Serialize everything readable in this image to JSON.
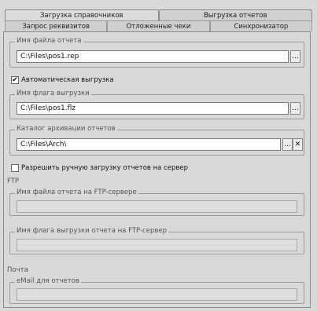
{
  "tabs_top": [
    {
      "label": "Загрузка справочников",
      "active": true
    },
    {
      "label": "Выгрузка отчетов",
      "active": false
    }
  ],
  "tabs_sub": [
    {
      "label": "Запрос реквизитов",
      "active": false
    },
    {
      "label": "Отложенные чеки",
      "active": false
    },
    {
      "label": "Синхронизатор",
      "active": false
    }
  ],
  "report_file": {
    "legend": "Имя файла отчета",
    "value": "C:\\Files\\pos1.rep",
    "browse": "..."
  },
  "auto_upload": {
    "label": "Автоматическая выгрузка",
    "checked": true,
    "mark": "✔"
  },
  "upload_flag": {
    "legend": "Имя флага выгрузки",
    "value": "C:\\Files\\pos1.flz",
    "browse": "..."
  },
  "archive_dir": {
    "legend": "Каталог архивации отчетов",
    "value": "C:\\Files\\Arch\\",
    "browse": "...",
    "clear": "✕"
  },
  "manual_upload": {
    "label": "Разрешить ручную загрузку отчетов на сервер",
    "checked": false
  },
  "ftp": {
    "section": "FTP",
    "report_file": {
      "legend": "Имя файла отчета на FTP-сервере",
      "value": ""
    },
    "upload_flag": {
      "legend": "Имя флага выгрузки отчета на FTP-сервер",
      "value": ""
    }
  },
  "mail": {
    "section": "Почта",
    "email": {
      "legend": "eMail для отчетов",
      "value": ""
    }
  }
}
